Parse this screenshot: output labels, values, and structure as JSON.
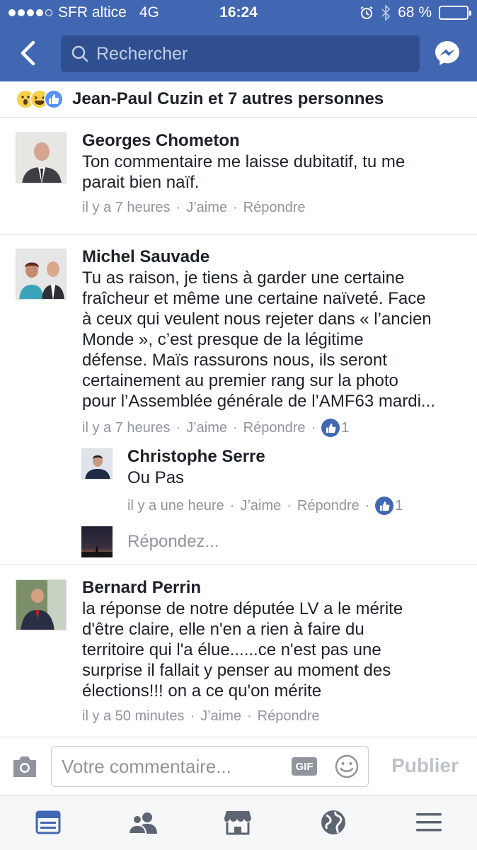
{
  "status_bar": {
    "carrier": "SFR altice",
    "network": "4G",
    "time": "16:24",
    "battery": "68 %",
    "battery_level": 0.68
  },
  "search": {
    "placeholder": "Rechercher"
  },
  "reactions": {
    "icons": [
      "wow-emoji",
      "haha-emoji",
      "like-icon"
    ],
    "summary": "Jean-Paul Cuzin et 7 autres personnes"
  },
  "comments": [
    {
      "author": "Georges Chometon",
      "lines": [
        "Ton commentaire me laisse dubitatif, tu me",
        "parait bien naïf."
      ],
      "time": "il y a 7 heures",
      "like_label": "J’aime",
      "reply_label": "Répondre"
    },
    {
      "author": "Michel Sauvade",
      "lines": [
        "Tu as raison, je tiens à garder une certaine",
        "fraîcheur et même une certaine naïveté. Face",
        "à ceux qui veulent nous rejeter dans « l’ancien",
        "Monde », c’est presque de la légitime",
        "défense. Maïs rassurons nous, ils seront",
        "certainement au premier rang sur la photo",
        "pour l’Assemblée générale de l’AMF63 mardi..."
      ],
      "time": "il y a 7 heures",
      "like_label": "J’aime",
      "reply_label": "Répondre",
      "likes": "1",
      "replies": [
        {
          "author": "Christophe Serre",
          "text": "Ou Pas",
          "time": "il y a une heure",
          "like_label": "J’aime",
          "reply_label": "Répondre",
          "likes": "1"
        }
      ],
      "reply_placeholder": "Répondez..."
    },
    {
      "author": "Bernard Perrin",
      "lines": [
        "la réponse de notre députée LV a le mérite",
        "d'être claire, elle n'en a rien à faire du",
        "territoire qui l'a élue......ce n'est pas une",
        "surprise il fallait y penser au moment des",
        "élections!!! on a ce qu'on mérite"
      ],
      "time": "il y a 50 minutes",
      "like_label": "J’aime",
      "reply_label": "Répondre"
    }
  ],
  "composer": {
    "placeholder": "Votre commentaire...",
    "gif_label": "GIF",
    "publish_label": "Publier"
  },
  "tabbar": [
    "news-feed-icon",
    "friends-icon",
    "marketplace-icon",
    "globe-icon",
    "menu-icon"
  ],
  "colors": {
    "brand": "#4267b2",
    "meta": "#90949c",
    "divider": "#dddfe2"
  }
}
